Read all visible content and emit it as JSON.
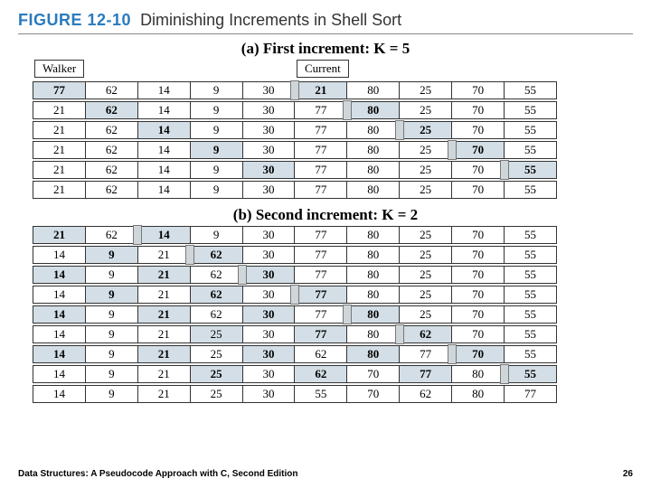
{
  "figure": {
    "number": "FIGURE 12-10",
    "title": "Diminishing Increments in Shell Sort"
  },
  "labels": {
    "walker": "Walker",
    "current": "Current"
  },
  "sectionA": "(a) First increment: K = 5",
  "sectionB": "(b) Second increment: K = 2",
  "cellW": 58,
  "rowsA": [
    {
      "cells": [
        77,
        62,
        14,
        9,
        30,
        21,
        80,
        25,
        70,
        55
      ],
      "hl": [
        0,
        5
      ],
      "bold": [
        0,
        5
      ],
      "gapAfter": 4
    },
    {
      "cells": [
        21,
        62,
        14,
        9,
        30,
        77,
        80,
        25,
        70,
        55
      ],
      "hl": [
        1,
        6
      ],
      "bold": [
        1,
        6
      ],
      "gapAfter": 5
    },
    {
      "cells": [
        21,
        62,
        14,
        9,
        30,
        77,
        80,
        25,
        70,
        55
      ],
      "hl": [
        2,
        7
      ],
      "bold": [
        2,
        7
      ],
      "gapAfter": 6
    },
    {
      "cells": [
        21,
        62,
        14,
        9,
        30,
        77,
        80,
        25,
        70,
        55
      ],
      "hl": [
        3,
        8
      ],
      "bold": [
        3,
        8
      ],
      "gapAfter": 7
    },
    {
      "cells": [
        21,
        62,
        14,
        9,
        30,
        77,
        80,
        25,
        70,
        55
      ],
      "hl": [
        4,
        9
      ],
      "bold": [
        4,
        9
      ],
      "gapAfter": 8
    },
    {
      "cells": [
        21,
        62,
        14,
        9,
        30,
        77,
        80,
        25,
        70,
        55
      ],
      "hl": [],
      "bold": [],
      "gapAfter": null
    }
  ],
  "rowsB": [
    {
      "cells": [
        21,
        62,
        14,
        9,
        30,
        77,
        80,
        25,
        70,
        55
      ],
      "hl": [
        0,
        2
      ],
      "bold": [
        0,
        2
      ],
      "gapAfter": 1
    },
    {
      "cells": [
        14,
        9,
        21,
        62,
        30,
        77,
        80,
        25,
        70,
        55
      ],
      "hl": [
        1,
        3
      ],
      "bold": [
        1,
        3
      ],
      "gapAfter": 2
    },
    {
      "cells": [
        14,
        9,
        21,
        62,
        30,
        77,
        80,
        25,
        70,
        55
      ],
      "hl": [
        0,
        2,
        4
      ],
      "bold": [
        0,
        2,
        4
      ],
      "gapAfter": 3
    },
    {
      "cells": [
        14,
        9,
        21,
        62,
        30,
        77,
        80,
        25,
        70,
        55
      ],
      "hl": [
        1,
        3,
        5
      ],
      "bold": [
        1,
        3,
        5
      ],
      "gapAfter": 4
    },
    {
      "cells": [
        14,
        9,
        21,
        62,
        30,
        77,
        80,
        25,
        70,
        55
      ],
      "hl": [
        0,
        2,
        4,
        6
      ],
      "bold": [
        0,
        2,
        4,
        6
      ],
      "gapAfter": 5
    },
    {
      "cells": [
        14,
        9,
        21,
        25,
        30,
        77,
        80,
        62,
        70,
        55
      ],
      "hl": [
        3,
        5,
        7
      ],
      "bold": [
        5,
        7
      ],
      "gapAfter": 6
    },
    {
      "cells": [
        14,
        9,
        21,
        25,
        30,
        62,
        80,
        77,
        70,
        55
      ],
      "hl": [
        0,
        2,
        4,
        6,
        8
      ],
      "bold": [
        0,
        2,
        4,
        6,
        8
      ],
      "gapAfter": 7
    },
    {
      "cells": [
        14,
        9,
        21,
        25,
        30,
        62,
        70,
        77,
        80,
        55
      ],
      "hl": [
        3,
        5,
        7,
        9
      ],
      "bold": [
        3,
        5,
        7,
        9
      ],
      "gapAfter": 8
    },
    {
      "cells": [
        14,
        9,
        21,
        25,
        30,
        55,
        70,
        62,
        80,
        77
      ],
      "hl": [],
      "bold": [],
      "gapAfter": null
    }
  ],
  "footer": {
    "text": "Data Structures: A Pseudocode Approach with C, Second Edition",
    "page": "26"
  }
}
